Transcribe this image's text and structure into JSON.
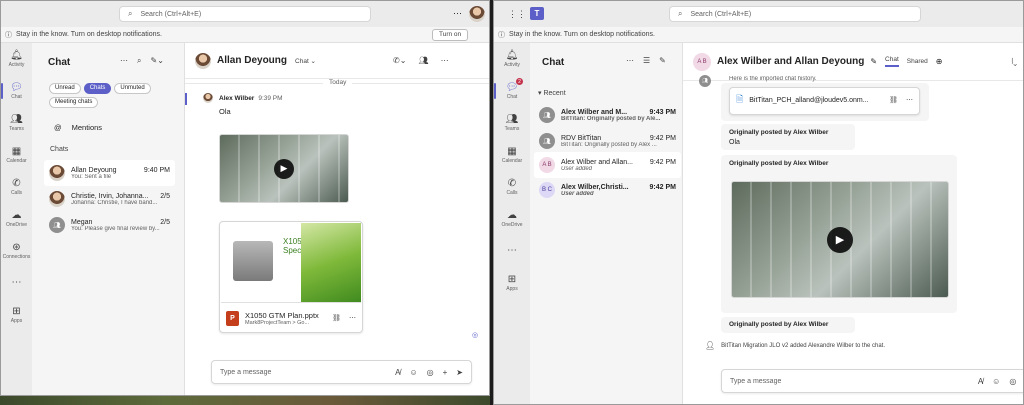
{
  "search_placeholder": "Search (Ctrl+Alt+E)",
  "notification": {
    "text": "Stay in the know. Turn on desktop notifications.",
    "button": "Turn on"
  },
  "rail_left": [
    "Activity",
    "Chat",
    "Teams",
    "Calendar",
    "Calls",
    "OneDrive",
    "Connections",
    "",
    "Apps"
  ],
  "rail_right": [
    "Activity",
    "Chat",
    "Teams",
    "Calendar",
    "Calls",
    "OneDrive",
    "",
    "Apps"
  ],
  "rail_right_badge": "2",
  "left": {
    "pane_title": "Chat",
    "filters": [
      "Unread",
      "Chats",
      "Unmuted",
      "Meeting chats"
    ],
    "mentions": "Mentions",
    "section": "Chats",
    "chats": [
      {
        "name": "Allan Deyoung",
        "time": "9:40 PM",
        "preview": "You: Sent a file"
      },
      {
        "name": "Christie, Irvin, Johanna...",
        "time": "2/5",
        "preview": "Johanna: Christie, I have band..."
      },
      {
        "name": "Megan",
        "time": "2/5",
        "preview": "You: Please give final review by..."
      }
    ],
    "header": {
      "name": "Allan Deyoung",
      "tab": "Chat"
    },
    "today": "Today",
    "message": {
      "author": "Alex Wilber",
      "time": "9:39 PM",
      "text": "Ola"
    },
    "file": {
      "slide_title": "X1051 Design Specifications",
      "name": "X1050 GTM Plan.pptx",
      "path": "Mark8ProjectTeam > Go..."
    },
    "compose_placeholder": "Type a message"
  },
  "right": {
    "pane_title": "Chat",
    "section": "Recent",
    "chats": [
      {
        "initials": "",
        "name": "Alex Wilber and M...",
        "time": "9:43 PM",
        "preview": "BitTitan: Originally posted by Ale..."
      },
      {
        "initials": "",
        "name": "RDV BitTitan",
        "time": "9:42 PM",
        "preview": "BitTitan: Originally posted by Alex ..."
      },
      {
        "initials": "A B",
        "name": "Alex Wilber and Allan...",
        "time": "9:42 PM",
        "preview": "User added"
      },
      {
        "initials": "B C",
        "name": "Alex Wilber,Christi...",
        "time": "9:42 PM",
        "preview": "User added"
      }
    ],
    "header": {
      "initials": "A B",
      "name": "Alex Wilber and Allan Deyoung",
      "tab_chat": "Chat",
      "tab_shared": "Shared"
    },
    "top_text": "Here is the imported chat history.",
    "file_name": "BitTitan_PCH_alland@jloudev5.onm...",
    "quote1_header": "Originally posted by Alex Wilber",
    "quote1_text": "Ola",
    "quote2_header": "Originally posted by Alex Wilber",
    "quote3_header": "Originally posted by Alex Wilber",
    "system_message": "BitTitan Migration JLO v2 added Alexandre Wilber to the chat.",
    "compose_placeholder": "Type a message"
  }
}
